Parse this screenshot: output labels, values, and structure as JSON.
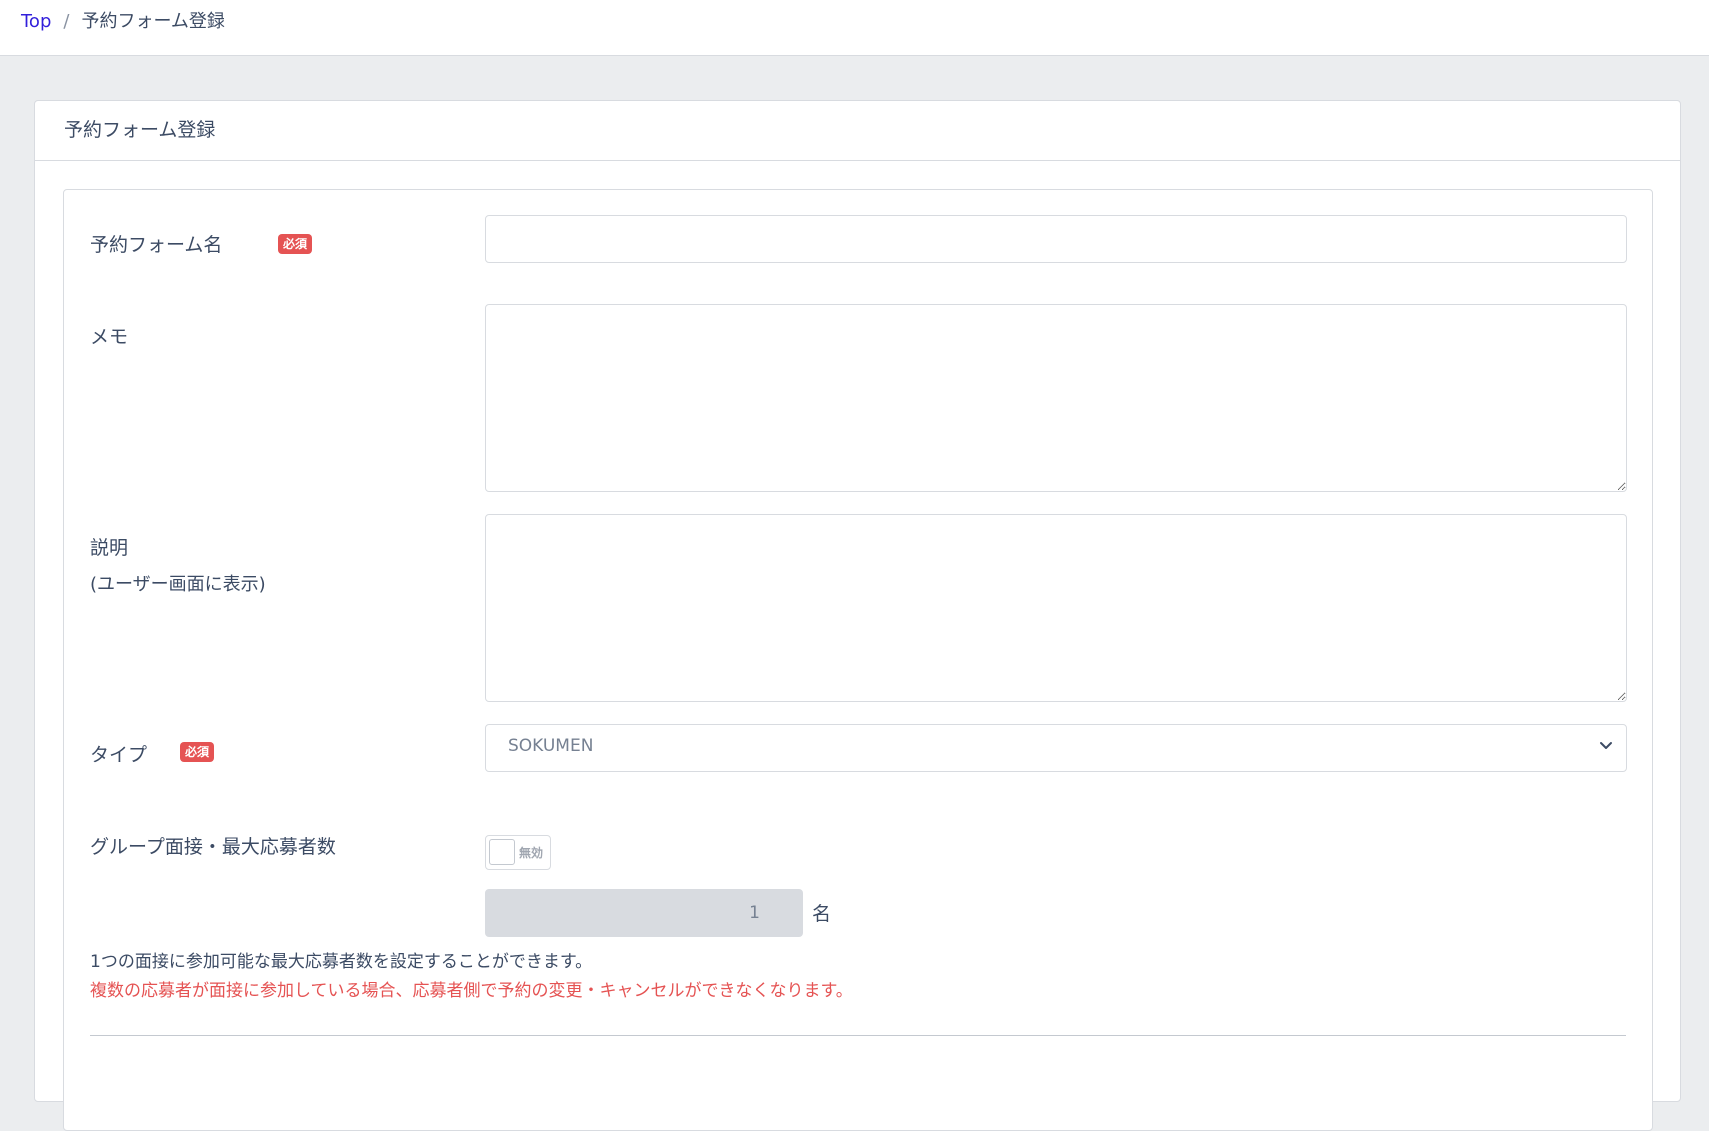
{
  "breadcrumb": {
    "home": "Top",
    "separator": "/",
    "current": "予約フォーム登録"
  },
  "card": {
    "title": "予約フォーム登録"
  },
  "form": {
    "name": {
      "label": "予約フォーム名",
      "badge": "必須",
      "value": "",
      "placeholder": ""
    },
    "memo": {
      "label": "メモ",
      "value": ""
    },
    "description": {
      "label": "説明",
      "sublabel": "(ユーザー画面に表示)",
      "value": ""
    },
    "type": {
      "label": "タイプ",
      "badge": "必須",
      "selected": "SOKUMEN"
    },
    "group": {
      "label": "グループ面接・最大応募者数",
      "toggle_label": "無効",
      "toggle_on": false,
      "max_value": "1",
      "unit": "名",
      "help": "1つの面接に参加可能な最大応募者数を設定することができます。",
      "warning": "複数の応募者が面接に参加している場合、応募者側で予約の変更・キャンセルができなくなります。"
    }
  },
  "colors": {
    "accent": "#321fdb",
    "danger": "#e55353",
    "text": "#3c4b64",
    "muted": "#768192"
  },
  "icons": {
    "select_arrow": "chevron-down-icon",
    "resize": "resize-grip-icon"
  }
}
